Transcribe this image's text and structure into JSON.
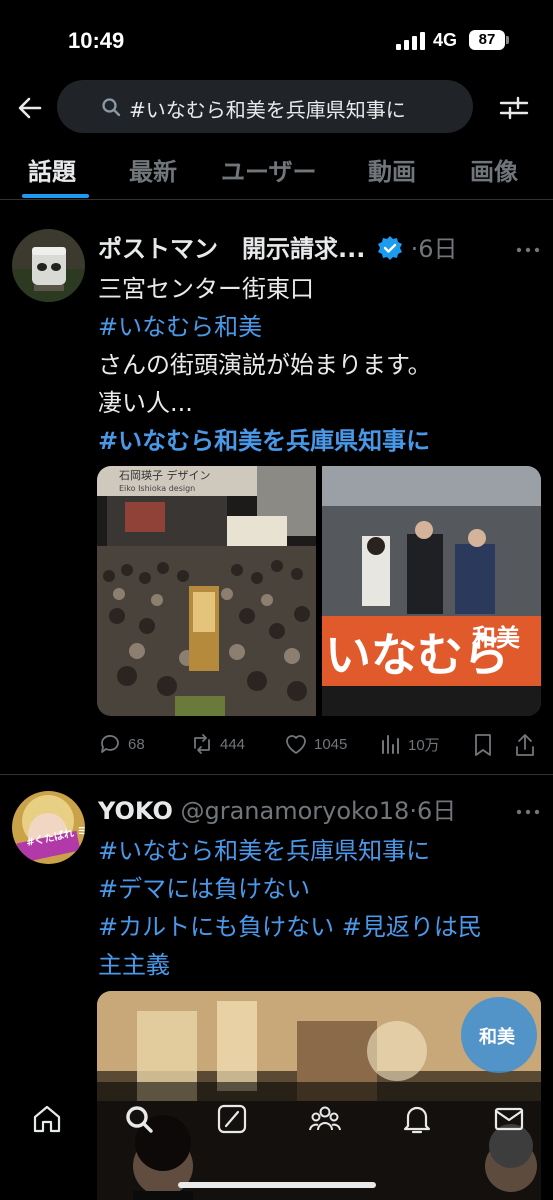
{
  "status_bar": {
    "time": "10:49",
    "network": "4G",
    "battery": "87"
  },
  "search": {
    "query": "#いなむら和美を兵庫県知事に"
  },
  "tabs": [
    {
      "label": "話題"
    },
    {
      "label": "最新"
    },
    {
      "label": "ユーザー"
    },
    {
      "label": "動画"
    },
    {
      "label": "画像"
    }
  ],
  "tweets": [
    {
      "user_name": "ポストマン　開示請求...",
      "time_ago": "·6日",
      "lines": [
        "三宮センター街東口",
        "#いなむら和美",
        "さんの街頭演説が始まります。",
        "凄い人...",
        "#いなむら和美を兵庫県知事に"
      ],
      "media_text": {
        "store_sign": "石岡瑛子 デザイン",
        "store_sign_sub": "Eiko Ishioka design",
        "banner": "いなむら",
        "banner_right": "和美"
      },
      "stats": {
        "replies": "68",
        "reposts": "444",
        "likes": "1045",
        "views": "10万"
      }
    },
    {
      "user_name": "YOKO",
      "handle": "@granamoryoko18",
      "time_ago": "·6日",
      "lines": [
        "#いなむら和美を兵庫県知事に",
        "#デマには負けない",
        "#カルトにも負けない #見返りは民",
        "主主義"
      ],
      "avatar_text": "#くたばれ ミンシー",
      "media_badge": "和美"
    }
  ],
  "colors": {
    "accent": "#1d9bf0",
    "hashtag": "#4a99e9",
    "muted": "#71767b",
    "background": "#000000"
  },
  "icons": {
    "nav": [
      "home-icon",
      "search-icon",
      "grok-icon",
      "communities-icon",
      "notifications-icon",
      "messages-icon"
    ]
  }
}
